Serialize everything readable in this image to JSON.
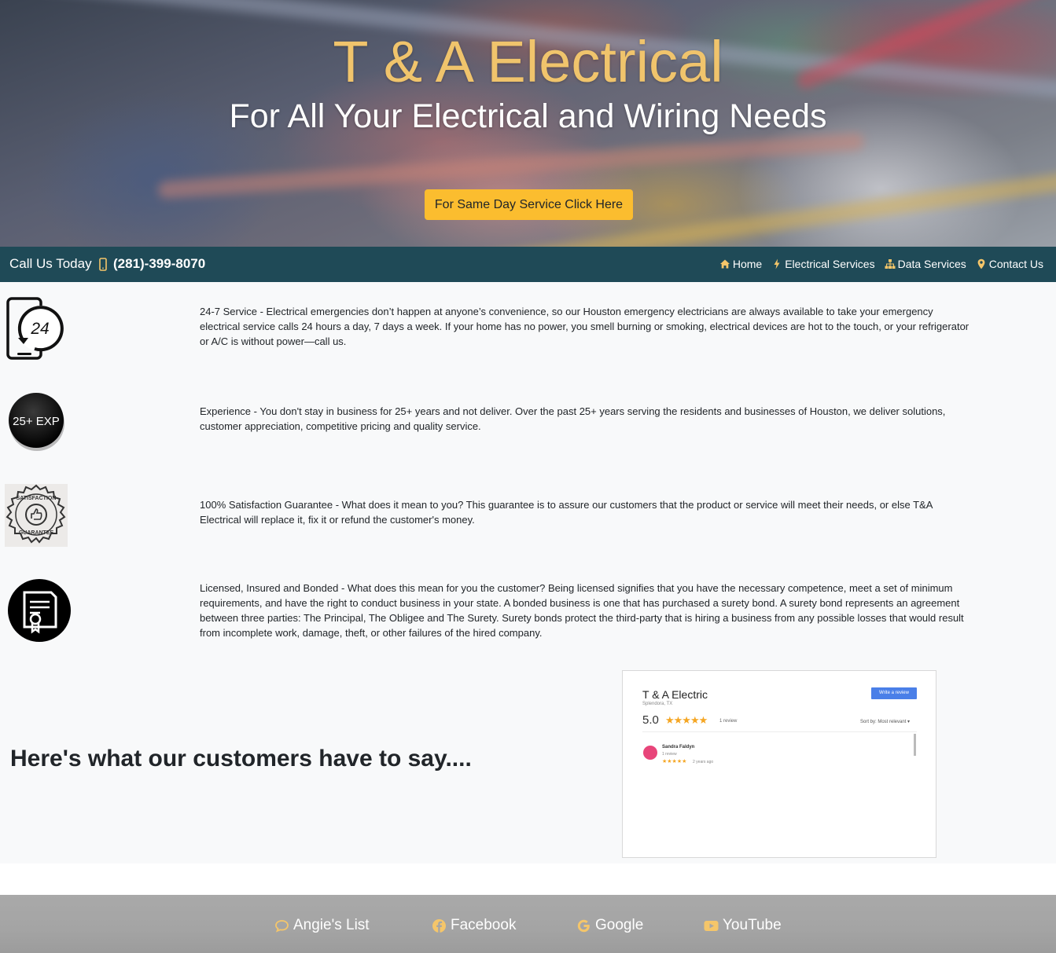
{
  "hero": {
    "title": "T & A Electrical",
    "subtitle": "For All Your Electrical and Wiring Needs",
    "cta_label": "For Same Day Service Click Here"
  },
  "navbar": {
    "call_label": "Call Us Today",
    "phone": "(281)-399-8070",
    "links": [
      {
        "label": "Home",
        "icon": "home-icon"
      },
      {
        "label": "Electrical Services",
        "icon": "bolt-icon"
      },
      {
        "label": "Data Services",
        "icon": "sitemap-icon"
      },
      {
        "label": "Contact Us",
        "icon": "map-marker-icon"
      }
    ]
  },
  "features": [
    {
      "icon": "24-hour-phone-icon",
      "text": "24-7 Service - Electrical emergencies don’t happen at anyone’s convenience, so our Houston emergency electricians are always available to take your emergency electrical service calls 24 hours a day, 7 days a week. If your home has no power, you smell burning or smoking, electrical devices are hot to the touch, or your refrigerator or A/C is without power—call us."
    },
    {
      "icon": "25-plus-exp-badge-icon",
      "badge_text": "25+ EXP",
      "text": "Experience - You don't stay in business for 25+ years and not deliver. Over the past 25+ years serving the residents and businesses of Houston, we deliver solutions, customer appreciation, competitive pricing and quality service."
    },
    {
      "icon": "satisfaction-guarantee-seal-icon",
      "text": "100% Satisfaction Guarantee - What does it mean to you? This guarantee is to assure our customers that the product or service will meet their needs, or else T&A Electrical will replace it, fix it or refund the customer's money."
    },
    {
      "icon": "certificate-icon",
      "text": "Licensed, Insured and Bonded - What does this mean for you the customer? Being licensed signifies that you have the necessary competence, meet a set of minimum requirements, and have the right to conduct business in your state. A bonded business is one that has purchased a surety bond. A surety bond represents an agreement between three parties: The Principal, The Obligee and The Surety. Surety bonds protect the third-party that is hiring a business from any possible losses that would result from incomplete work, damage, theft, or other failures of the hired company."
    }
  ],
  "reviews": {
    "heading": "Here's what our customers have to say....",
    "card": {
      "business": "T & A Electric",
      "location": "Splendora, TX",
      "write_review": "Write a review",
      "score": "5.0",
      "stars": "★★★★★",
      "count": "1 review",
      "sort": "Sort by: Most relevant ▾",
      "reviewer": "Sandra Faldyn",
      "reviewer_count": "1 review",
      "review_stars": "★★★★★",
      "review_time": "2 years ago"
    }
  },
  "footer": {
    "links": [
      {
        "label": "Angie's List",
        "icon": "comment-icon"
      },
      {
        "label": "Facebook",
        "icon": "facebook-icon"
      },
      {
        "label": "Google",
        "icon": "google-icon"
      },
      {
        "label": "YouTube",
        "icon": "youtube-icon"
      }
    ]
  },
  "colors": {
    "accent_gold": "#f0c46c",
    "cta_yellow": "#fbbd2f",
    "navbar_teal": "#1f4a57",
    "nav_icon_gold": "#f5c66a",
    "footer_gray": "#a6a6a6"
  }
}
